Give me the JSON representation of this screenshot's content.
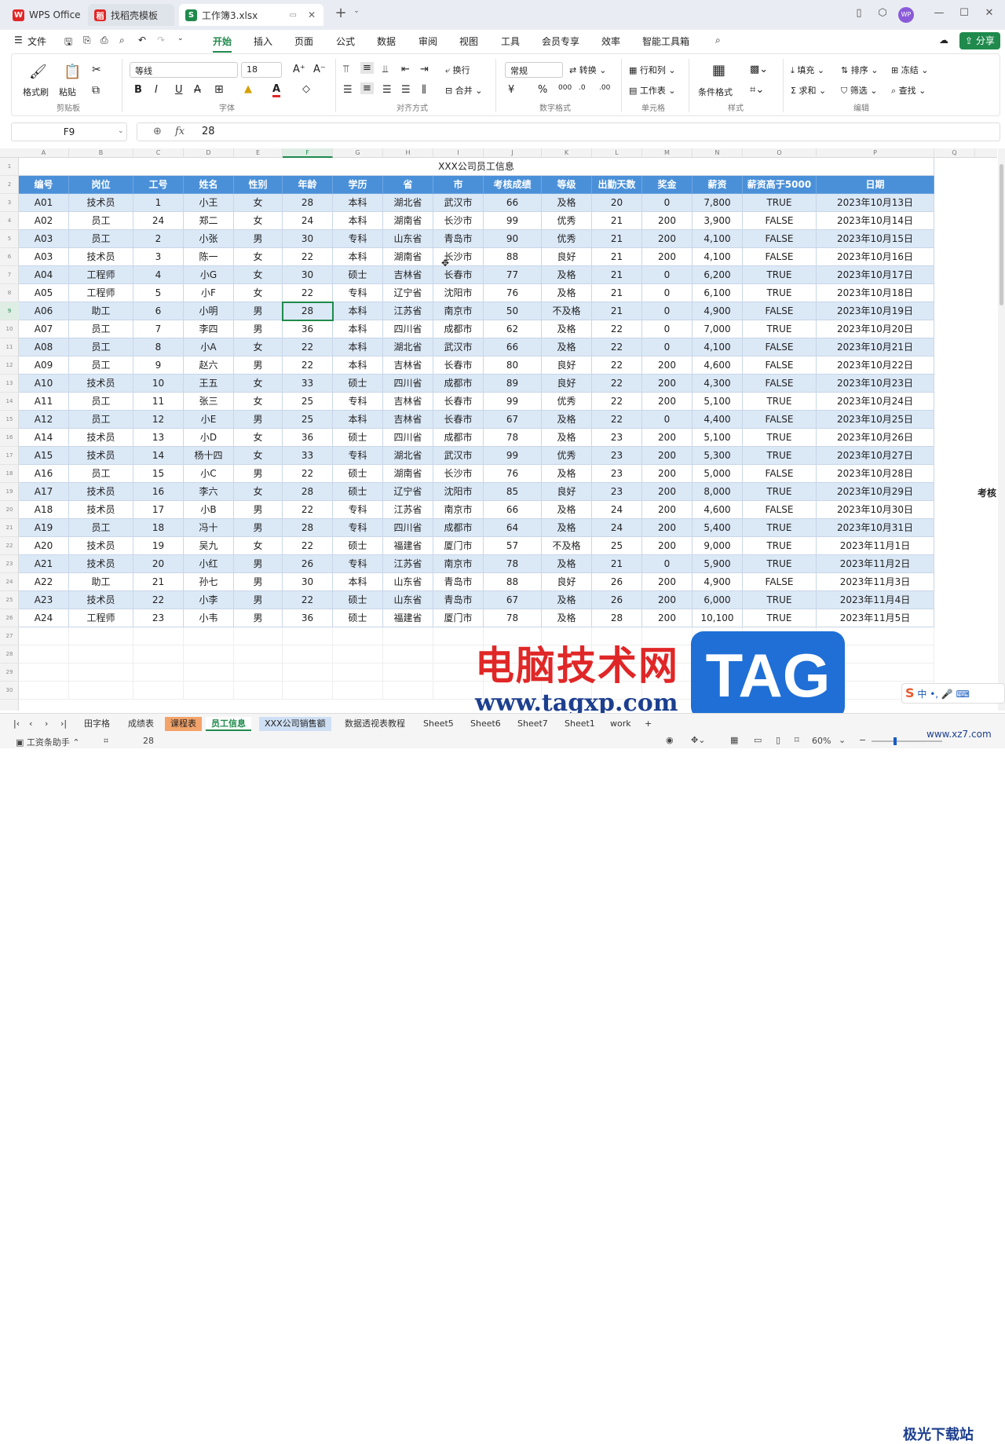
{
  "tabs": [
    {
      "label": "WPS Office",
      "icon": "W"
    },
    {
      "label": "找稻壳模板",
      "icon": "稻"
    },
    {
      "label": "工作簿3.xlsx",
      "icon": "S"
    }
  ],
  "menu": {
    "file": "文件",
    "items": [
      "开始",
      "插入",
      "页面",
      "公式",
      "数据",
      "审阅",
      "视图",
      "工具",
      "会员专享",
      "效率",
      "智能工具箱"
    ],
    "active": 0,
    "share": "分享"
  },
  "ribbon": {
    "groups": [
      "剪贴板",
      "字体",
      "对齐方式",
      "数字格式",
      "单元格",
      "样式",
      "编辑"
    ],
    "clipboard": {
      "format_painter": "格式刷",
      "paste": "粘贴"
    },
    "font": {
      "name": "等线",
      "size": "18"
    },
    "align": {
      "wrap": "换行",
      "merge": "合并"
    },
    "number": {
      "format": "常规",
      "convert": "转换"
    },
    "cells": {
      "rowcol": "行和列",
      "sheet": "工作表"
    },
    "style": {
      "cond": "条件格式"
    },
    "edit": {
      "fill": "填充",
      "sort": "排序",
      "freeze": "冻结",
      "sum": "求和",
      "filter": "筛选",
      "find": "查找"
    }
  },
  "formula": {
    "cell_ref": "F9",
    "fx": "fx",
    "value": "28"
  },
  "columns": [
    "A",
    "B",
    "C",
    "D",
    "E",
    "F",
    "G",
    "H",
    "I",
    "J",
    "K",
    "L",
    "M",
    "N",
    "O",
    "P",
    "Q"
  ],
  "table": {
    "title": "XXX公司员工信息",
    "headers": [
      "编号",
      "岗位",
      "工号",
      "姓名",
      "性别",
      "年龄",
      "学历",
      "省",
      "市",
      "考核成绩",
      "等级",
      "出勤天数",
      "奖金",
      "薪资",
      "薪资高于5000",
      "日期"
    ],
    "rows": [
      [
        "A01",
        "技术员",
        "1",
        "小王",
        "女",
        "28",
        "本科",
        "湖北省",
        "武汉市",
        "66",
        "及格",
        "20",
        "0",
        "7,800",
        "TRUE",
        "2023年10月13日"
      ],
      [
        "A02",
        "员工",
        "24",
        "郑二",
        "女",
        "24",
        "本科",
        "湖南省",
        "长沙市",
        "99",
        "优秀",
        "21",
        "200",
        "3,900",
        "FALSE",
        "2023年10月14日"
      ],
      [
        "A03",
        "员工",
        "2",
        "小张",
        "男",
        "30",
        "专科",
        "山东省",
        "青岛市",
        "90",
        "优秀",
        "21",
        "200",
        "4,100",
        "FALSE",
        "2023年10月15日"
      ],
      [
        "A03",
        "技术员",
        "3",
        "陈一",
        "女",
        "22",
        "本科",
        "湖南省",
        "长沙市",
        "88",
        "良好",
        "21",
        "200",
        "4,100",
        "FALSE",
        "2023年10月16日"
      ],
      [
        "A04",
        "工程师",
        "4",
        "小G",
        "女",
        "30",
        "硕士",
        "吉林省",
        "长春市",
        "77",
        "及格",
        "21",
        "0",
        "6,200",
        "TRUE",
        "2023年10月17日"
      ],
      [
        "A05",
        "工程师",
        "5",
        "小F",
        "女",
        "22",
        "专科",
        "辽宁省",
        "沈阳市",
        "76",
        "及格",
        "21",
        "0",
        "6,100",
        "TRUE",
        "2023年10月18日"
      ],
      [
        "A06",
        "助工",
        "6",
        "小明",
        "男",
        "28",
        "本科",
        "江苏省",
        "南京市",
        "50",
        "不及格",
        "21",
        "0",
        "4,900",
        "FALSE",
        "2023年10月19日"
      ],
      [
        "A07",
        "员工",
        "7",
        "李四",
        "男",
        "36",
        "本科",
        "四川省",
        "成都市",
        "62",
        "及格",
        "22",
        "0",
        "7,000",
        "TRUE",
        "2023年10月20日"
      ],
      [
        "A08",
        "员工",
        "8",
        "小A",
        "女",
        "22",
        "本科",
        "湖北省",
        "武汉市",
        "66",
        "及格",
        "22",
        "0",
        "4,100",
        "FALSE",
        "2023年10月21日"
      ],
      [
        "A09",
        "员工",
        "9",
        "赵六",
        "男",
        "22",
        "本科",
        "吉林省",
        "长春市",
        "80",
        "良好",
        "22",
        "200",
        "4,600",
        "FALSE",
        "2023年10月22日"
      ],
      [
        "A10",
        "技术员",
        "10",
        "王五",
        "女",
        "33",
        "硕士",
        "四川省",
        "成都市",
        "89",
        "良好",
        "22",
        "200",
        "4,300",
        "FALSE",
        "2023年10月23日"
      ],
      [
        "A11",
        "员工",
        "11",
        "张三",
        "女",
        "25",
        "专科",
        "吉林省",
        "长春市",
        "99",
        "优秀",
        "22",
        "200",
        "5,100",
        "TRUE",
        "2023年10月24日"
      ],
      [
        "A12",
        "员工",
        "12",
        "小E",
        "男",
        "25",
        "本科",
        "吉林省",
        "长春市",
        "67",
        "及格",
        "22",
        "0",
        "4,400",
        "FALSE",
        "2023年10月25日"
      ],
      [
        "A14",
        "技术员",
        "13",
        "小D",
        "女",
        "36",
        "硕士",
        "四川省",
        "成都市",
        "78",
        "及格",
        "23",
        "200",
        "5,100",
        "TRUE",
        "2023年10月26日"
      ],
      [
        "A15",
        "技术员",
        "14",
        "杨十四",
        "女",
        "33",
        "专科",
        "湖北省",
        "武汉市",
        "99",
        "优秀",
        "23",
        "200",
        "5,300",
        "TRUE",
        "2023年10月27日"
      ],
      [
        "A16",
        "员工",
        "15",
        "小C",
        "男",
        "22",
        "硕士",
        "湖南省",
        "长沙市",
        "76",
        "及格",
        "23",
        "200",
        "5,000",
        "FALSE",
        "2023年10月28日"
      ],
      [
        "A17",
        "技术员",
        "16",
        "李六",
        "女",
        "28",
        "硕士",
        "辽宁省",
        "沈阳市",
        "85",
        "良好",
        "23",
        "200",
        "8,000",
        "TRUE",
        "2023年10月29日"
      ],
      [
        "A18",
        "技术员",
        "17",
        "小B",
        "男",
        "22",
        "专科",
        "江苏省",
        "南京市",
        "66",
        "及格",
        "24",
        "200",
        "4,600",
        "FALSE",
        "2023年10月30日"
      ],
      [
        "A19",
        "员工",
        "18",
        "冯十",
        "男",
        "28",
        "专科",
        "四川省",
        "成都市",
        "64",
        "及格",
        "24",
        "200",
        "5,400",
        "TRUE",
        "2023年10月31日"
      ],
      [
        "A20",
        "技术员",
        "19",
        "吴九",
        "女",
        "22",
        "硕士",
        "福建省",
        "厦门市",
        "57",
        "不及格",
        "25",
        "200",
        "9,000",
        "TRUE",
        "2023年11月1日"
      ],
      [
        "A21",
        "技术员",
        "20",
        "小红",
        "男",
        "26",
        "专科",
        "江苏省",
        "南京市",
        "78",
        "及格",
        "21",
        "0",
        "5,900",
        "TRUE",
        "2023年11月2日"
      ],
      [
        "A22",
        "助工",
        "21",
        "孙七",
        "男",
        "30",
        "本科",
        "山东省",
        "青岛市",
        "88",
        "良好",
        "26",
        "200",
        "4,900",
        "FALSE",
        "2023年11月3日"
      ],
      [
        "A23",
        "技术员",
        "22",
        "小李",
        "男",
        "22",
        "硕士",
        "山东省",
        "青岛市",
        "67",
        "及格",
        "26",
        "200",
        "6,000",
        "TRUE",
        "2023年11月4日"
      ],
      [
        "A24",
        "工程师",
        "23",
        "小韦",
        "男",
        "36",
        "硕士",
        "福建省",
        "厦门市",
        "78",
        "及格",
        "28",
        "200",
        "10,100",
        "TRUE",
        "2023年11月5日"
      ]
    ],
    "side_label": "考核"
  },
  "sheets": [
    "田字格",
    "成绩表",
    "课程表",
    "员工信息",
    "XXX公司销售额",
    "数据透视表教程",
    "Sheet5",
    "Sheet6",
    "Sheet7",
    "Sheet1",
    "work"
  ],
  "active_sheet": 3,
  "status": {
    "assistant": "工资条助手",
    "value": "28",
    "zoom": "60%"
  },
  "watermark": {
    "cn": "电脑技术网",
    "url": "www.tagxp.com",
    "tag": "TAG",
    "site": "极光下载站",
    "site_url": "www.xz7.com"
  },
  "ime": "中"
}
